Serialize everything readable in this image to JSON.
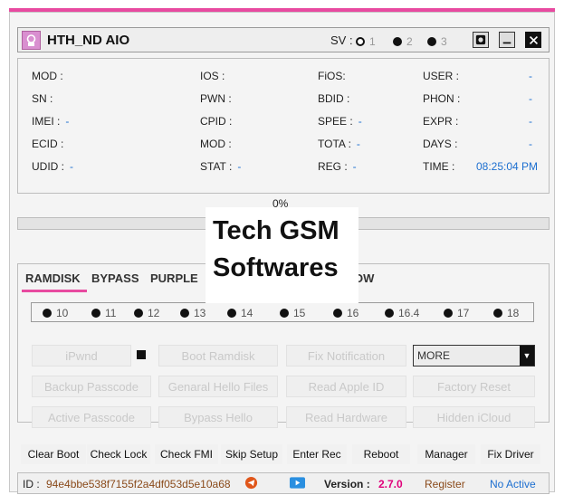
{
  "app": {
    "title": "HTH_ND AIO",
    "sv_label": "SV :",
    "sv_options": [
      "1",
      "2",
      "3"
    ]
  },
  "info": {
    "col1": [
      {
        "label": "MOD :",
        "value": ""
      },
      {
        "label": "SN :",
        "value": ""
      },
      {
        "label": "IMEI :",
        "value": "-"
      },
      {
        "label": "ECID :",
        "value": ""
      },
      {
        "label": "UDID :",
        "value": "-"
      }
    ],
    "col2": [
      {
        "label": "IOS :",
        "value": ""
      },
      {
        "label": "PWN :",
        "value": ""
      },
      {
        "label": "CPID :",
        "value": ""
      },
      {
        "label": "MOD :",
        "value": ""
      },
      {
        "label": "STAT :",
        "value": "-"
      }
    ],
    "col3": [
      {
        "label": "FiOS:",
        "value": ""
      },
      {
        "label": "BDID :",
        "value": ""
      },
      {
        "label": "SPEE :",
        "value": "-"
      },
      {
        "label": "TOTA :",
        "value": "-"
      },
      {
        "label": "REG :",
        "value": "-"
      }
    ],
    "col4": [
      {
        "label": "USER :",
        "value": "-"
      },
      {
        "label": "PHON :",
        "value": "-"
      },
      {
        "label": "EXPR :",
        "value": "-"
      },
      {
        "label": "DAYS :",
        "value": "-"
      },
      {
        "label": "TIME :",
        "value": "08:25:04 PM"
      }
    ]
  },
  "progress": {
    "percent_text": "0%",
    "value": 0
  },
  "tabs": [
    "RAMDISK",
    "BYPASS",
    "PURPLE",
    "OW"
  ],
  "versions": [
    "10",
    "11",
    "12",
    "13",
    "14",
    "15",
    "16",
    "16.4",
    "17",
    "18"
  ],
  "buttons": {
    "ipwnd": "iPwnd",
    "boot_ramdisk": "Boot Ramdisk",
    "fix_notification": "Fix Notification",
    "more_select": "MORE",
    "backup_passcode": "Backup Passcode",
    "general_hello_files": "Genaral Hello Files",
    "read_apple_id": "Read Apple ID",
    "factory_reset": "Factory Reset",
    "active_passcode": "Active Passcode",
    "bypass_hello": "Bypass Hello",
    "read_hardware": "Read Hardware",
    "hidden_icloud": "Hidden iCloud"
  },
  "actions": [
    "Clear Boot",
    "Check Lock",
    "Check FMI",
    "Skip Setup",
    "Enter Rec",
    "Reboot",
    "Manager",
    "Fix Driver"
  ],
  "status": {
    "id_label": "ID :",
    "id_value": "94e4bbe538f7155f2a4df053d5e10a68",
    "version_label": "Version :",
    "version_value": "2.7.0",
    "register": "Register",
    "active": "No Active"
  },
  "overlay": {
    "line1": "Tech GSM",
    "line2": "Softwares"
  },
  "colors": {
    "accent": "#e84aa0",
    "value_blue": "#1d6fd0",
    "id_brown": "#8a4a1a",
    "version_orange": "#e0007a"
  }
}
